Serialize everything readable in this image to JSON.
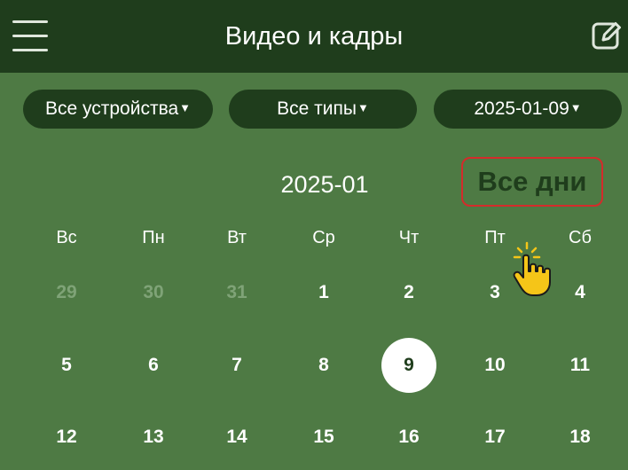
{
  "header": {
    "title": "Видео и кадры"
  },
  "filters": {
    "devices": "Все устройства",
    "types": "Все типы",
    "date": "2025-01-09",
    "caret": "▼"
  },
  "calendar": {
    "month": "2025-01",
    "all_days": "Все дни",
    "weekdays": [
      "Вс",
      "Пн",
      "Вт",
      "Ср",
      "Чт",
      "Пт",
      "Сб"
    ],
    "weeks": [
      [
        "29",
        "30",
        "31",
        "1",
        "2",
        "3",
        "4"
      ],
      [
        "5",
        "6",
        "7",
        "8",
        "9",
        "10",
        "11"
      ],
      [
        "12",
        "13",
        "14",
        "15",
        "16",
        "17",
        "18"
      ]
    ],
    "selected_day": "9"
  },
  "colors": {
    "header_bg": "#1f3d1c",
    "content_bg": "#4e7a44",
    "highlight_border": "#d42b2b",
    "muted_day": "#7fa377",
    "cursor_fill": "#f5c518"
  },
  "icons": {
    "menu": "hamburger-icon",
    "edit": "edit-icon",
    "cursor": "pointing-hand-icon"
  }
}
